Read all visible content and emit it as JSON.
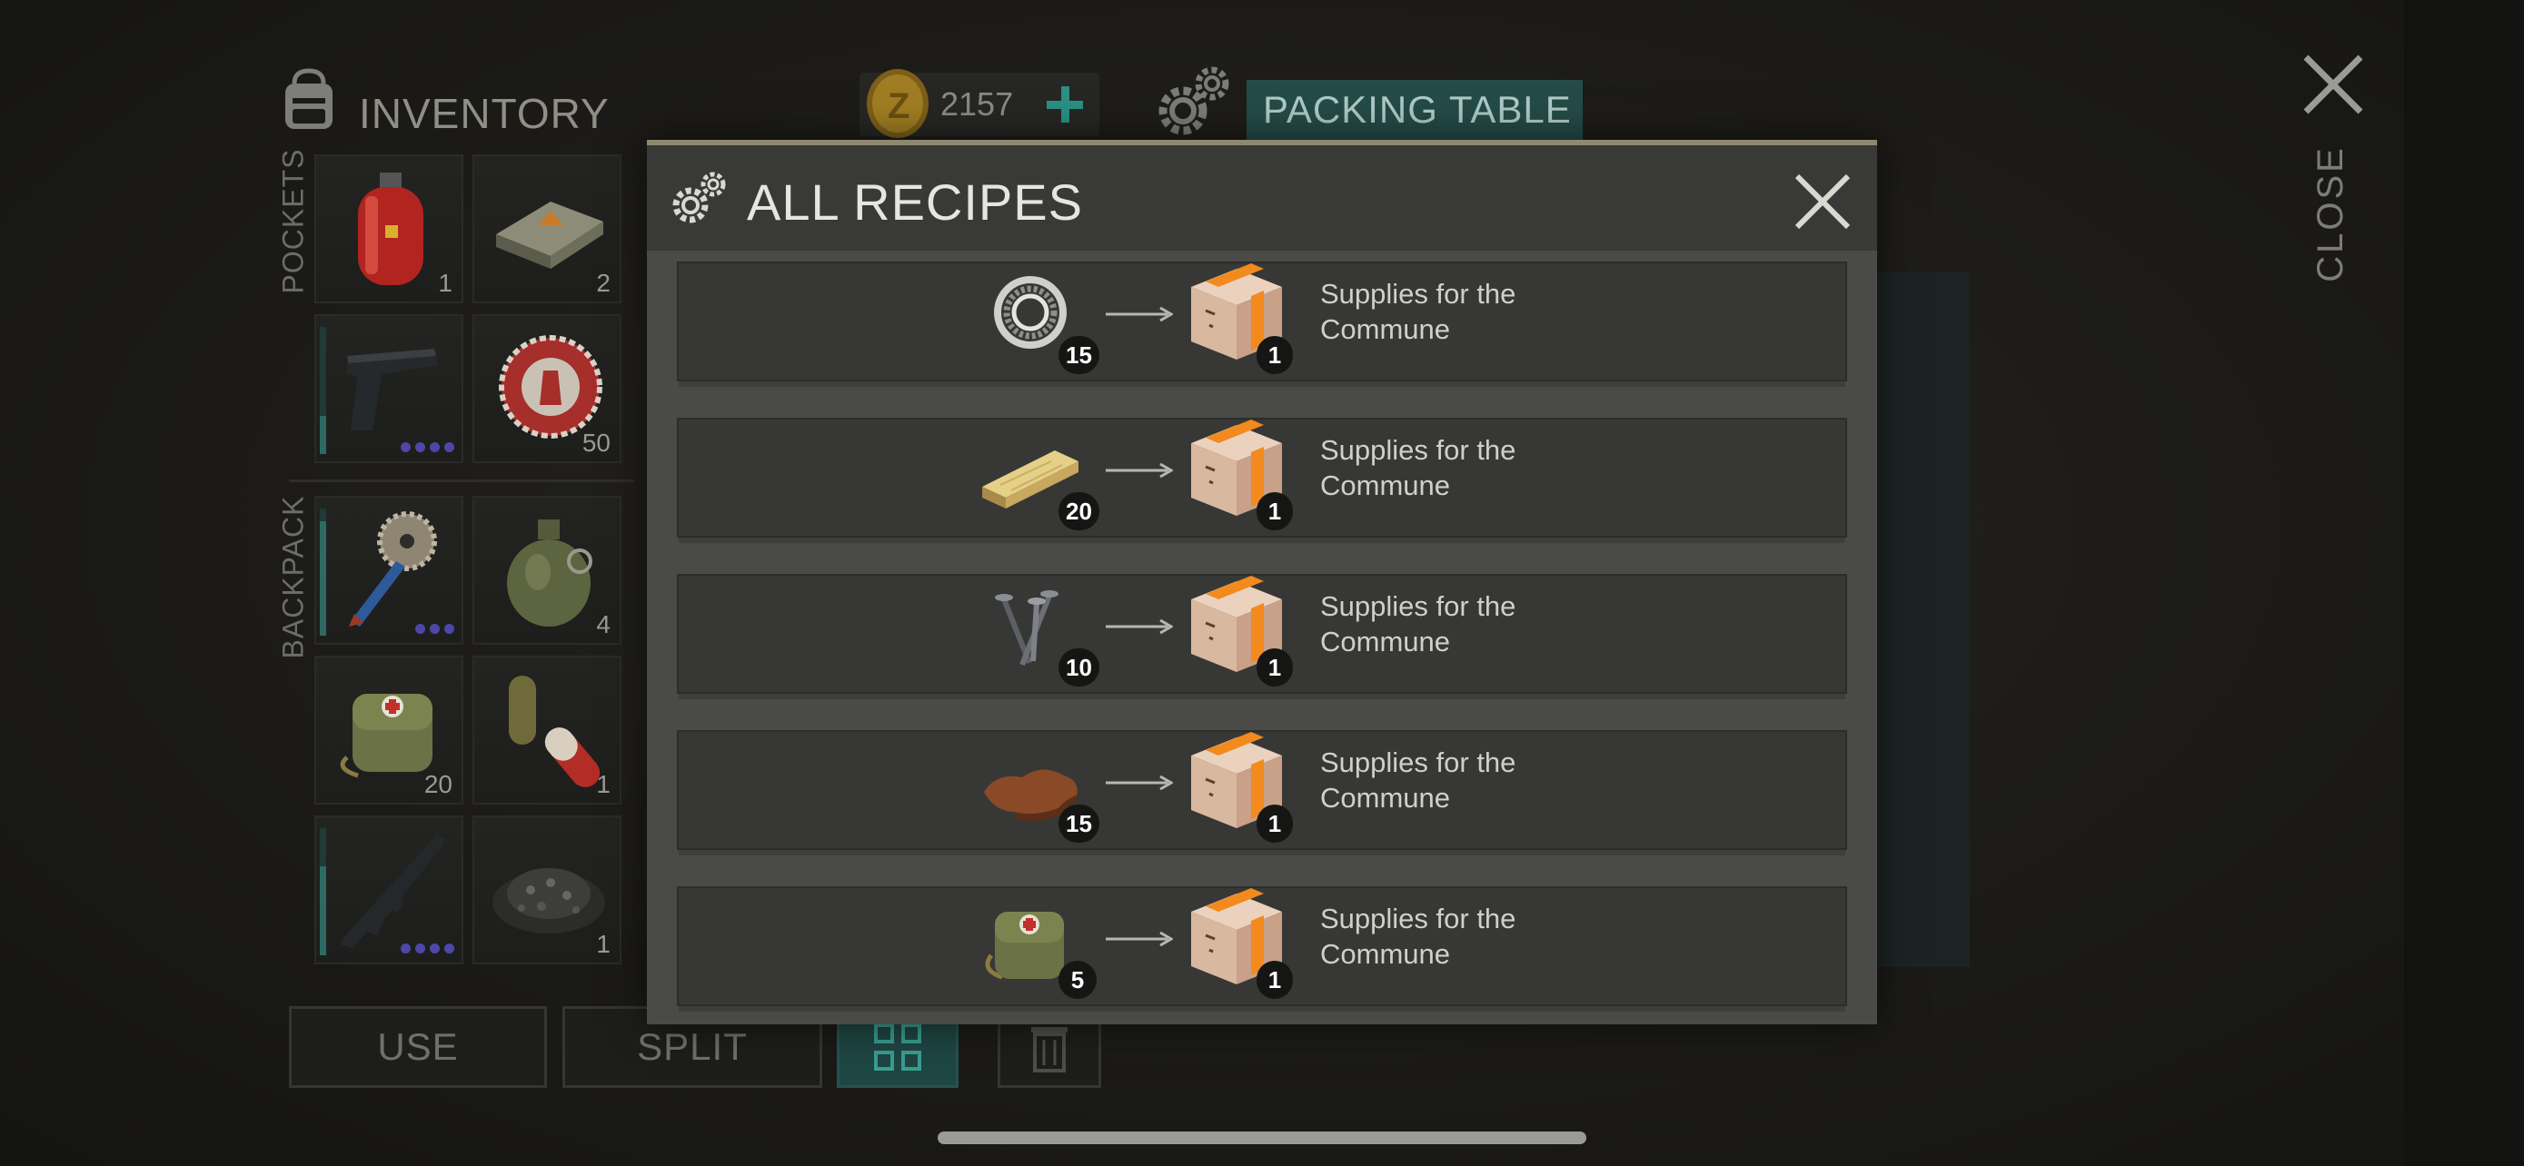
{
  "inventory": {
    "title": "INVENTORY",
    "pockets_label": "POCKETS",
    "backpack_label": "BACKPACK",
    "slots": [
      {
        "icon": "gas-canister-icon",
        "count": "1"
      },
      {
        "icon": "soap-bar-icon",
        "count": "2"
      },
      {
        "icon": "pistol-icon",
        "count": "",
        "durability": 0.3
      },
      {
        "icon": "bottle-cap-icon",
        "count": "50"
      },
      {
        "icon": "saw-blade-club-icon",
        "count": "",
        "durability": 0.9
      },
      {
        "icon": "grenade-icon",
        "count": "4"
      },
      {
        "icon": "medical-bag-icon",
        "count": "20"
      },
      {
        "icon": "pill-capsule-icon",
        "count": "1"
      },
      {
        "icon": "assault-rifle-icon",
        "count": "",
        "durability": 0.7
      },
      {
        "icon": "gravel-pile-icon",
        "count": "1"
      }
    ]
  },
  "currency": {
    "amount": "2157",
    "plus_label": "+"
  },
  "crafting_station": {
    "title": "PACKING TABLE"
  },
  "close": {
    "label": "CLOSE"
  },
  "buttons": {
    "use": "USE",
    "split": "SPLIT"
  },
  "modal": {
    "title": "ALL RECIPES",
    "recipes": [
      {
        "ingredient_icon": "bearing-ring-icon",
        "ingredient_count": "15",
        "result_icon": "cardboard-box-icon",
        "result_count": "1",
        "result_name": "Supplies for the Commune"
      },
      {
        "ingredient_icon": "wooden-plank-icon",
        "ingredient_count": "20",
        "result_icon": "cardboard-box-icon",
        "result_count": "1",
        "result_name": "Supplies for the Commune"
      },
      {
        "ingredient_icon": "nails-icon",
        "ingredient_count": "10",
        "result_icon": "cardboard-box-icon",
        "result_count": "1",
        "result_name": "Supplies for the Commune"
      },
      {
        "ingredient_icon": "leather-icon",
        "ingredient_count": "15",
        "result_icon": "cardboard-box-icon",
        "result_count": "1",
        "result_name": "Supplies for the Commune"
      },
      {
        "ingredient_icon": "medical-bag-icon",
        "ingredient_count": "5",
        "result_icon": "cardboard-box-icon",
        "result_count": "1",
        "result_name": "Supplies for the Commune"
      }
    ]
  },
  "colors": {
    "accent_teal": "#244b48",
    "modal_border": "#8f8870",
    "dots": "#4e47a8"
  }
}
